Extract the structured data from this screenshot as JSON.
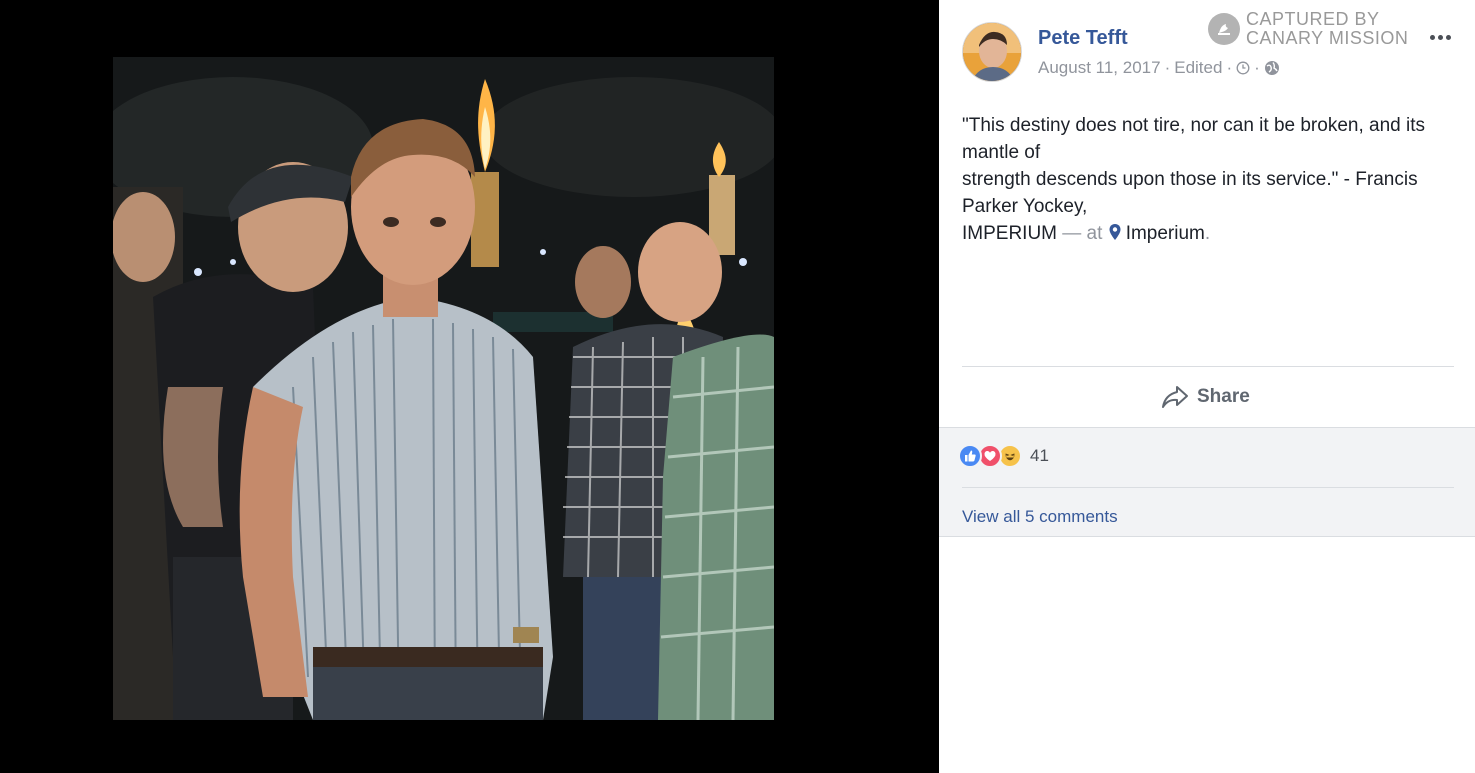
{
  "author": {
    "name": "Pete Tefft"
  },
  "post_meta": {
    "date": "August 11, 2017",
    "sep1": "·",
    "edited": "Edited",
    "sep2": "·",
    "sep3": "·",
    "clock_icon": "clock-icon",
    "audience_icon": "globe-icon"
  },
  "watermark": {
    "line1": "CAPTURED BY",
    "line2": "CANARY MISSION"
  },
  "post": {
    "line1": "\"This destiny does not tire, nor can it be broken, and its mantle of",
    "line2": "strength descends upon those in its service.\" - Francis Parker Yockey,",
    "line3": "IMPERIUM",
    "at_text": " — at ",
    "place": "Imperium",
    "period": "."
  },
  "actions": {
    "share_label": "Share"
  },
  "feedback": {
    "reaction_count": "41",
    "reactions": [
      "like",
      "love",
      "haha"
    ],
    "view_comments": "View all 5 comments"
  },
  "colors": {
    "link": "#365899",
    "muted": "#90949c",
    "text": "#1d2129",
    "like": "#4a89f3",
    "love": "#f0506a",
    "haha": "#f6c24a"
  }
}
